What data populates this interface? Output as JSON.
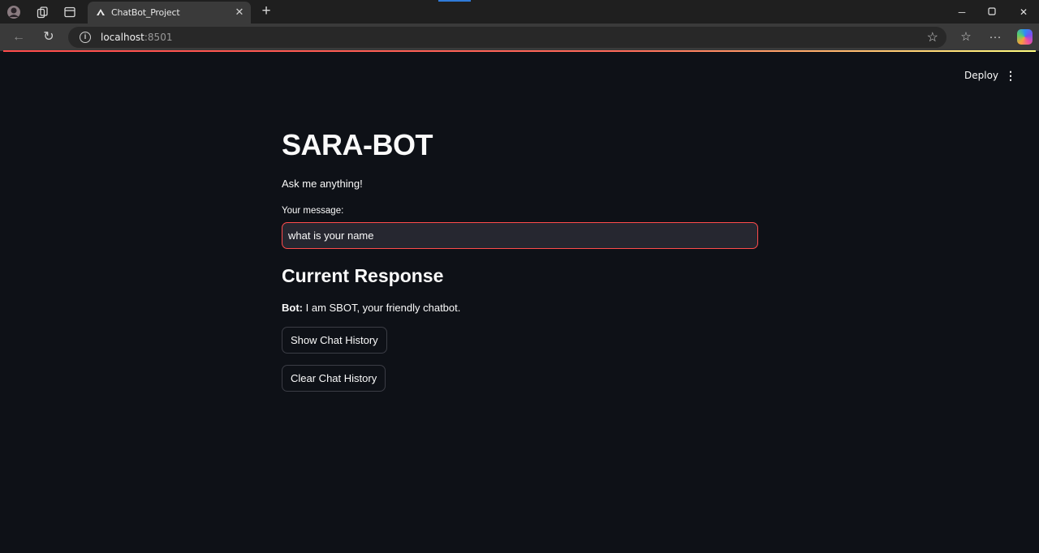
{
  "browser": {
    "tab_title": "ChatBot_Project",
    "url_host": "localhost",
    "url_port": ":8501"
  },
  "app": {
    "deploy_label": "Deploy",
    "title": "SARA-BOT",
    "subtitle": "Ask me anything!",
    "input_label": "Your message:",
    "input_value": "what is your name",
    "section_heading": "Current Response",
    "bot_prefix": "Bot:",
    "bot_response": " I am SBOT, your friendly chatbot.",
    "show_history_label": "Show Chat History",
    "clear_history_label": "Clear Chat History"
  },
  "colors": {
    "background": "#0e1117",
    "accent": "#ff4b4b",
    "input_bg": "#262730",
    "text": "#fafafa"
  },
  "icons": [
    "profile-avatar-icon",
    "collections-icon",
    "tab-actions-icon",
    "streamlit-favicon",
    "close-icon",
    "new-tab-icon",
    "minimize-icon",
    "maximize-icon",
    "close-window-icon",
    "back-icon",
    "refresh-icon",
    "info-icon",
    "favorite-star-icon",
    "favorites-icon",
    "more-icon",
    "copilot-icon",
    "kebab-menu-icon"
  ]
}
